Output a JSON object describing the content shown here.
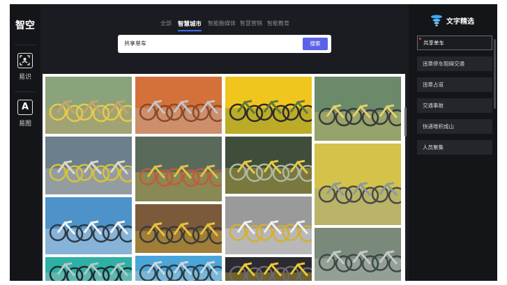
{
  "app": {
    "logo": "智空"
  },
  "sidebar": {
    "items": [
      {
        "label": "易识",
        "icon": "scan-icon"
      },
      {
        "label": "易图",
        "icon": "text-a-icon",
        "glyph": "A"
      }
    ]
  },
  "nav": {
    "items": [
      {
        "label": "全部"
      },
      {
        "label": "智慧城市"
      },
      {
        "label": "智能融媒体"
      },
      {
        "label": "智慧营销"
      },
      {
        "label": "智能教育"
      }
    ],
    "active_index": 1
  },
  "search": {
    "value": "共享单车",
    "button_label": "搜索"
  },
  "gallery": {
    "images": [
      {
        "name": "bikes-shared-parking-1",
        "palette": [
          "#8aa37a",
          "#c9a56a",
          "#e8c94a"
        ]
      },
      {
        "name": "bikes-street-rows-1",
        "palette": [
          "#6b7f8c",
          "#e0d8c8",
          "#d9c23a"
        ]
      },
      {
        "name": "bikes-blue-closeup",
        "palette": [
          "#4d93c9",
          "#f2f2f2",
          "#2f3a44"
        ]
      },
      {
        "name": "bikes-teal-row",
        "palette": [
          "#2fb0a5",
          "#b8c8c8",
          "#1f2a2e"
        ]
      },
      {
        "name": "bikes-orange-rack",
        "palette": [
          "#d4713a",
          "#c0c6cc",
          "#8a4a2a"
        ]
      },
      {
        "name": "bikes-mixed-crossing",
        "palette": [
          "#5a6a5a",
          "#e0c34a",
          "#c45a3a"
        ]
      },
      {
        "name": "bikes-yellow-pile",
        "palette": [
          "#7a5a3a",
          "#e8c23a",
          "#3a3a3a"
        ]
      },
      {
        "name": "bikes-blue-lineup",
        "palette": [
          "#4aa6d8",
          "#d0d6da",
          "#2e3a42"
        ]
      },
      {
        "name": "bikes-yellow-row-park",
        "palette": [
          "#f0c51e",
          "#5b7a3a",
          "#2a2a2a"
        ]
      },
      {
        "name": "bikes-road-lane",
        "palette": [
          "#3e4e3a",
          "#e8c94a",
          "#b0b8a0"
        ]
      },
      {
        "name": "bikes-white-street",
        "palette": [
          "#9a9a9a",
          "#f0f0f0",
          "#d4b030"
        ]
      },
      {
        "name": "bikes-night-rider",
        "palette": [
          "#2a2a30",
          "#f0c830",
          "#6a6a70"
        ]
      },
      {
        "name": "bikes-bottom-1",
        "palette": [
          "#6a8a6a",
          "#e8d06a",
          "#3a3a3a"
        ]
      },
      {
        "name": "bikes-bottom-2",
        "palette": [
          "#d4c24a",
          "#8a9aa0",
          "#4a4a4a"
        ]
      },
      {
        "name": "bikes-bottom-3",
        "palette": [
          "#7a8a7a",
          "#c8c8c8",
          "#3a4a4a"
        ]
      }
    ]
  },
  "panel": {
    "title": "文字精选",
    "icon": "tornado-icon",
    "keywords": [
      {
        "label": "共享单车"
      },
      {
        "label": "违章停车阻碍交通"
      },
      {
        "label": "违章占道"
      },
      {
        "label": "交通事故"
      },
      {
        "label": "快递堆积成山"
      },
      {
        "label": "人员聚集"
      }
    ],
    "active_index": 0
  },
  "colors": {
    "accent": "#5a63e8",
    "nav_underline": "#3a6af5",
    "bg": "#1b1c21",
    "rail": "#141519"
  }
}
